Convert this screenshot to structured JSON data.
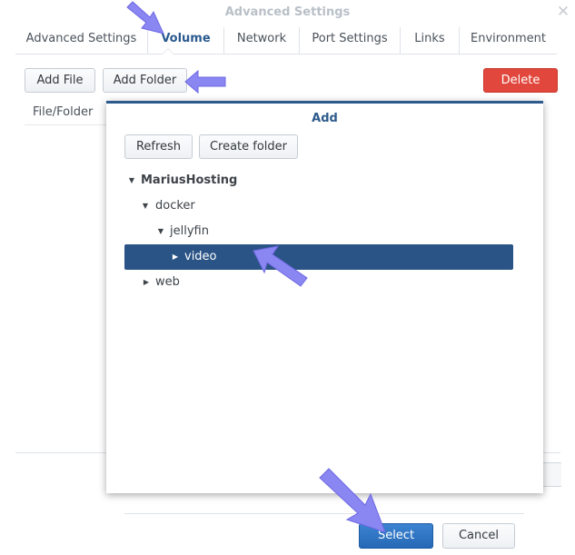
{
  "window": {
    "title": "Advanced Settings",
    "close_glyph": "✕"
  },
  "tabs": [
    {
      "label": "Advanced Settings"
    },
    {
      "label": "Volume"
    },
    {
      "label": "Network"
    },
    {
      "label": "Port Settings"
    },
    {
      "label": "Links"
    },
    {
      "label": "Environment"
    }
  ],
  "toolbar": {
    "add_file": "Add File",
    "add_folder": "Add Folder",
    "delete": "Delete"
  },
  "list": {
    "column_header": "File/Folder"
  },
  "dialog": {
    "title": "Add",
    "refresh": "Refresh",
    "create_folder": "Create folder",
    "tree": [
      {
        "label": "MariusHosting",
        "expanded": true
      },
      {
        "label": "docker",
        "expanded": true
      },
      {
        "label": "jellyfin",
        "expanded": true
      },
      {
        "label": "video",
        "expanded": false,
        "selected": true
      },
      {
        "label": "web",
        "expanded": false
      }
    ],
    "select": "Select",
    "cancel": "Cancel"
  },
  "colors": {
    "accent": "#2d5a8c",
    "selected_row": "#2b5486",
    "delete_red": "#e1473c",
    "primary_blue": "#2668b6",
    "pointer_arrow": "#8a86f2"
  },
  "icons": {
    "expanded": "▼",
    "collapsed": "▶"
  }
}
